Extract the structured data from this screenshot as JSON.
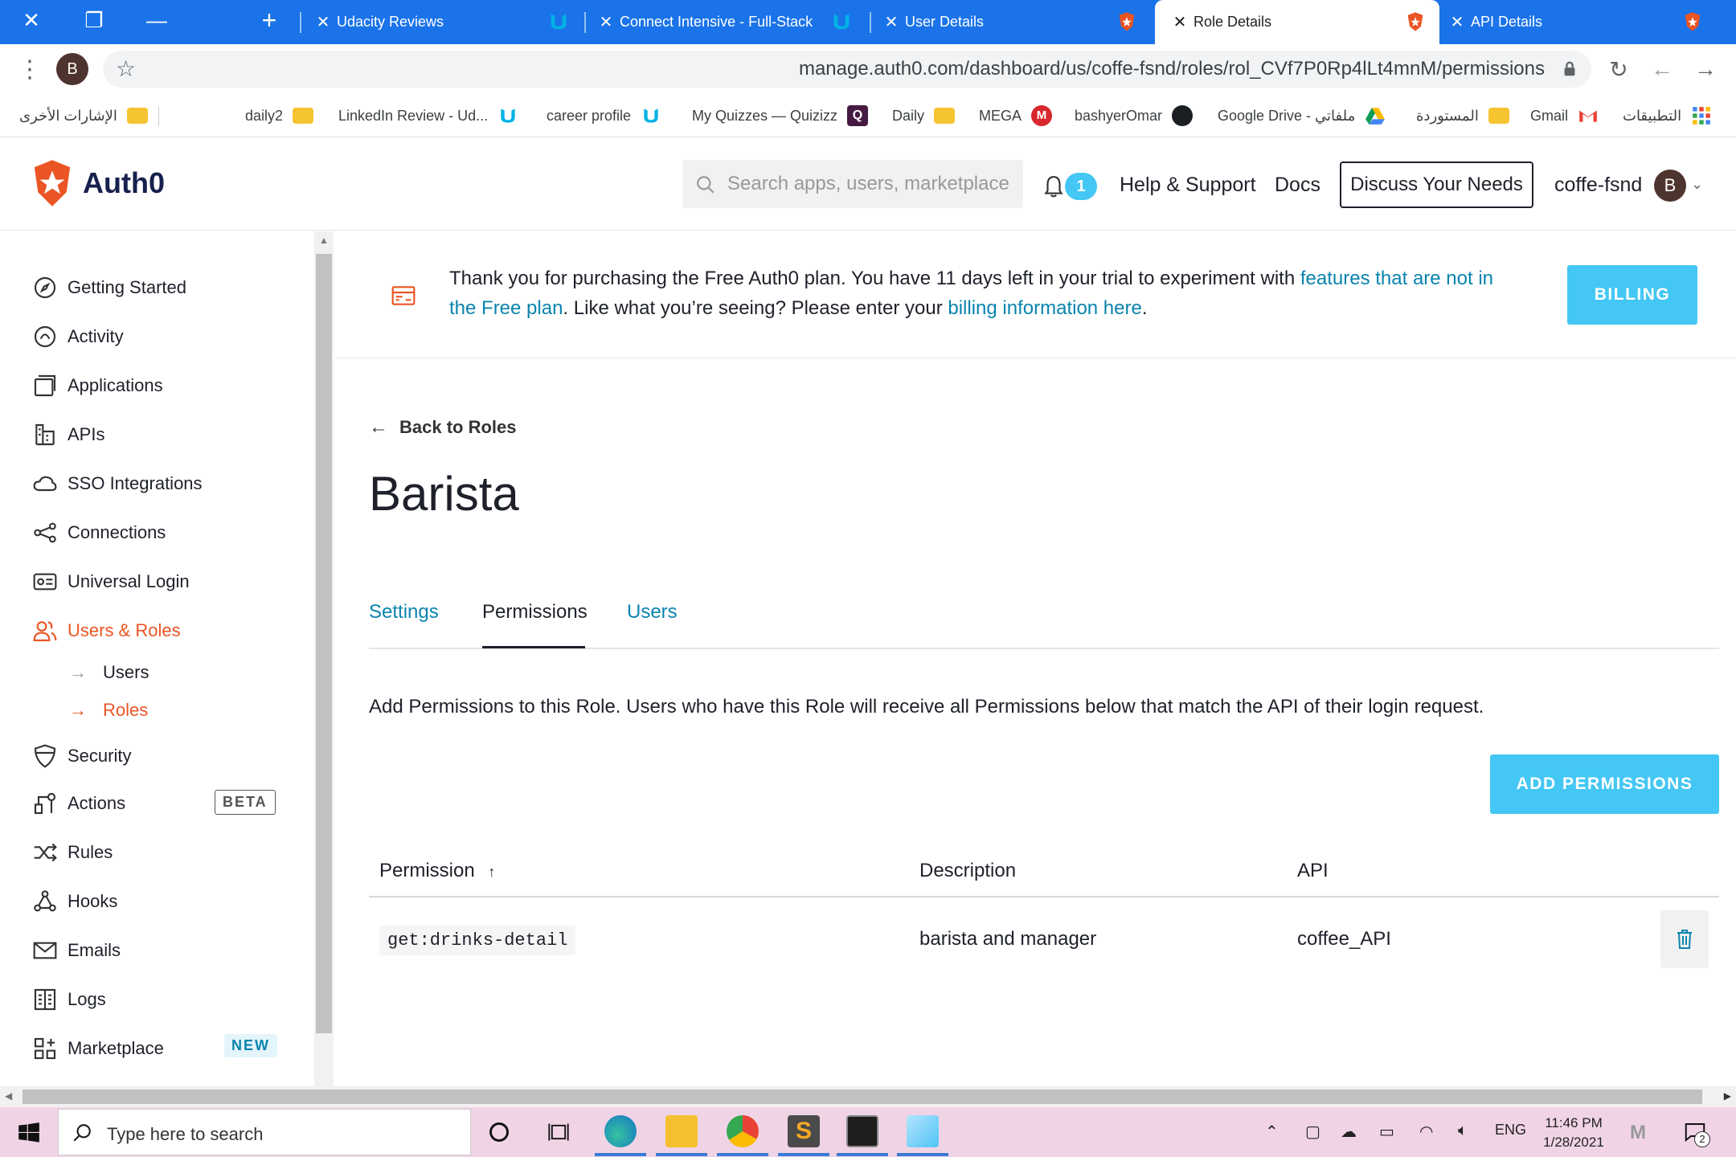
{
  "browser": {
    "tabs": [
      {
        "title": "Udacity Reviews",
        "active": false
      },
      {
        "title": "Connect Intensive - Full-Stack",
        "active": false
      },
      {
        "title": "User Details",
        "active": false
      },
      {
        "title": "Role Details",
        "active": true
      },
      {
        "title": "API Details",
        "active": false
      }
    ],
    "url": "manage.auth0.com/dashboard/us/coffe-fsnd/roles/rol_CVf7P0Rp4lLt4mnM/permissions",
    "profile_initial": "B",
    "bookmarks": [
      "الإشارات الأخرى",
      "daily2",
      "LinkedIn Review - Ud...",
      "career profile",
      "My Quizzes — Quizizz",
      "Daily",
      "MEGA",
      "bashyerOmar",
      "Google Drive - ملفاتي",
      "المستوردة",
      "Gmail",
      "التطبيقات"
    ]
  },
  "header": {
    "logo": "Auth0",
    "search_placeholder": "Search apps, users, marketplace",
    "notifications_count": "1",
    "help": "Help & Support",
    "docs": "Docs",
    "discuss": "Discuss Your Needs",
    "tenant": "coffe-fsnd",
    "avatar_initial": "B"
  },
  "sidebar": {
    "items": [
      {
        "label": "Getting Started",
        "icon": "compass-icon"
      },
      {
        "label": "Activity",
        "icon": "activity-icon"
      },
      {
        "label": "Applications",
        "icon": "applications-icon"
      },
      {
        "label": "APIs",
        "icon": "apis-icon"
      },
      {
        "label": "SSO Integrations",
        "icon": "cloud-icon"
      },
      {
        "label": "Connections",
        "icon": "connections-icon"
      },
      {
        "label": "Universal Login",
        "icon": "login-icon"
      },
      {
        "label": "Users & Roles",
        "icon": "users-icon"
      },
      {
        "label": "Security",
        "icon": "shield-icon"
      },
      {
        "label": "Actions",
        "icon": "actions-icon",
        "badge": "BETA"
      },
      {
        "label": "Rules",
        "icon": "rules-icon"
      },
      {
        "label": "Hooks",
        "icon": "hooks-icon"
      },
      {
        "label": "Emails",
        "icon": "email-icon"
      },
      {
        "label": "Logs",
        "icon": "logs-icon"
      },
      {
        "label": "Marketplace",
        "icon": "marketplace-icon",
        "badge": "NEW"
      }
    ],
    "subitems": [
      {
        "label": "Users"
      },
      {
        "label": "Roles"
      }
    ]
  },
  "banner": {
    "text_1": "Thank you for purchasing the Free Auth0 plan. You have 11 days left in your trial to experiment with ",
    "link_1": "features that are not in the Free plan",
    "text_2": ". Like what you’re seeing? Please enter your ",
    "link_2": "billing information here",
    "text_3": ".",
    "button": "BILLING"
  },
  "page": {
    "back": "Back to Roles",
    "title": "Barista",
    "tabs": [
      "Settings",
      "Permissions",
      "Users"
    ],
    "description": "Add Permissions to this Role. Users who have this Role will receive all Permissions below that match the API of their login request.",
    "add_button": "ADD PERMISSIONS"
  },
  "table": {
    "headers": [
      "Permission",
      "Description",
      "API"
    ],
    "rows": [
      {
        "permission": "get:drinks-detail",
        "description": "barista and manager",
        "api": "coffee_API"
      }
    ]
  },
  "taskbar": {
    "search": "Type here to search",
    "language": "ENG",
    "time": "11:46 PM",
    "date": "1/28/2021",
    "notification_count": "2"
  },
  "colors": {
    "accent_orange": "#eb5424",
    "button_blue": "#44c7f4",
    "link_blue": "#0a84ae",
    "chrome_blue": "#1a73e8"
  }
}
